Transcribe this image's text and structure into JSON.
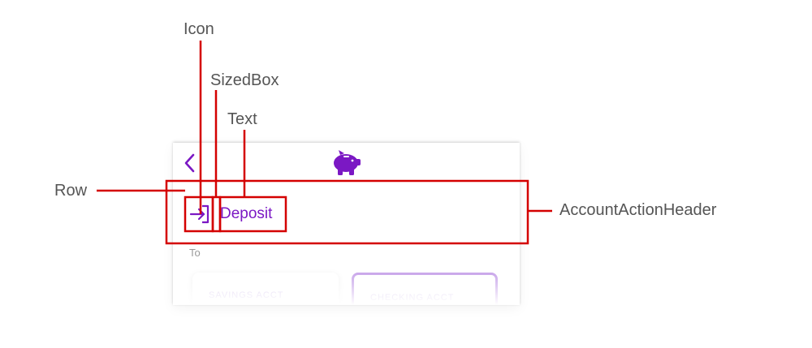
{
  "annotations": {
    "icon": "Icon",
    "sized_box": "SizedBox",
    "text": "Text",
    "row": "Row",
    "account_action_header": "AccountActionHeader"
  },
  "app": {
    "back_icon": "chevron-left-icon",
    "logo_icon": "piggy-bank-icon",
    "accent_color": "#7b18c4",
    "header": {
      "icon": "login-arrow-icon",
      "title": "Deposit"
    },
    "to_label": "To",
    "accounts": [
      {
        "label": "SAVINGS ACCT",
        "selected": false
      },
      {
        "label": "CHECKING ACCT",
        "selected": true
      }
    ]
  },
  "colors": {
    "callout": "#d40000",
    "label_text": "#555555"
  }
}
